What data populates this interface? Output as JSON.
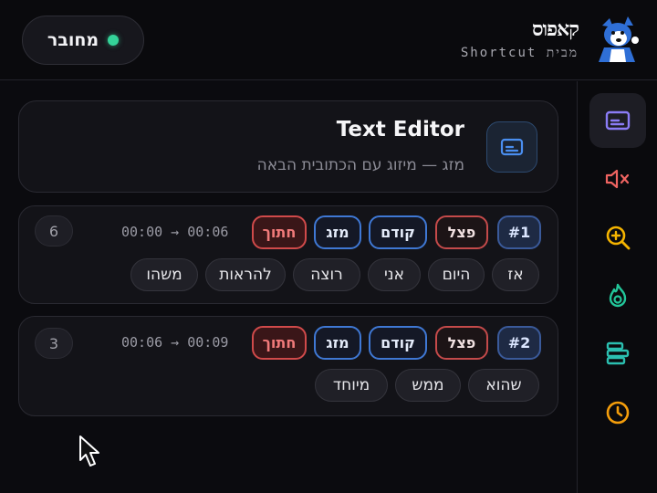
{
  "header": {
    "status_label": "מחובר",
    "brand_name": "קאפוס",
    "brand_sub": "מבית Shortcut"
  },
  "colors": {
    "status_online": "#34d399",
    "accent_blue": "#3f78d4",
    "accent_red": "#d04a4a"
  },
  "sidebar": {
    "items": [
      {
        "icon": "subtitles-icon",
        "active": true,
        "color": "#8b7cf6"
      },
      {
        "icon": "mute-icon",
        "active": false,
        "color": "#ef6461"
      },
      {
        "icon": "zoom-in-icon",
        "active": false,
        "color": "#f5b400"
      },
      {
        "icon": "flame-icon",
        "active": false,
        "color": "#22c79a"
      },
      {
        "icon": "timeline-icon",
        "active": false,
        "color": "#2bbfb0"
      },
      {
        "icon": "clock-icon",
        "active": false,
        "color": "#f59e0b"
      }
    ]
  },
  "editor": {
    "title": "Text Editor",
    "subtitle": "מזג — מיזוג עם הכתובית הבאה",
    "icon": "subtitles-icon"
  },
  "segments": [
    {
      "id": "#1",
      "actions": [
        "פצל",
        "קודם",
        "מזג",
        "חתוך"
      ],
      "timing": "00:00 → 00:06",
      "count": "6",
      "words": [
        "אז",
        "היום",
        "אני",
        "רוצה",
        "להראות",
        "משהו"
      ]
    },
    {
      "id": "#2",
      "actions": [
        "פצל",
        "קודם",
        "מזג",
        "חתוך"
      ],
      "timing": "00:06 → 00:09",
      "count": "3",
      "words": [
        "שהוא",
        "ממש",
        "מיוחד"
      ]
    }
  ]
}
